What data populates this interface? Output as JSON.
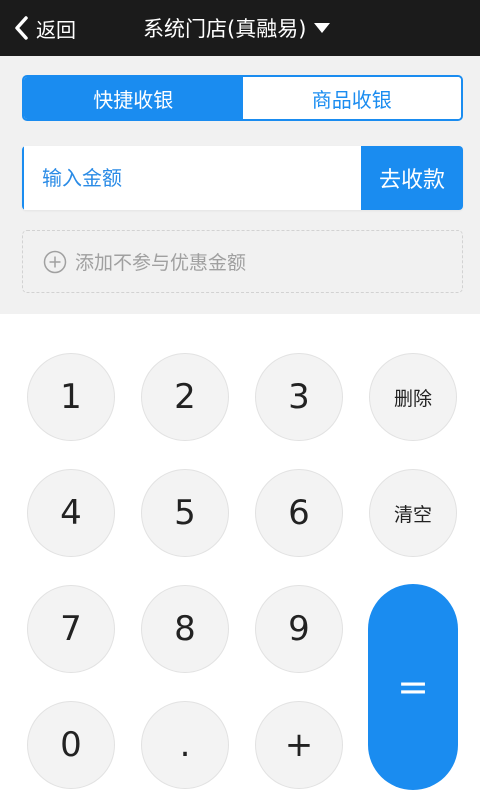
{
  "header": {
    "back_label": "返回",
    "title": "系统门店(真融易)"
  },
  "tabs": [
    {
      "label": "快捷收银",
      "active": true
    },
    {
      "label": "商品收银",
      "active": false
    }
  ],
  "amount": {
    "placeholder": "输入金额",
    "collect_label": "去收款"
  },
  "discount": {
    "label": "添加不参与优惠金额"
  },
  "keypad": {
    "keys": [
      "1",
      "2",
      "3",
      "删除",
      "4",
      "5",
      "6",
      "清空",
      "7",
      "8",
      "9",
      "0",
      ".",
      "+"
    ],
    "equals": "="
  },
  "colors": {
    "accent": "#1a8cf0",
    "header_bg": "#1b1b1b",
    "page_bg": "#f1f1f1",
    "key_bg": "#f3f3f3"
  }
}
